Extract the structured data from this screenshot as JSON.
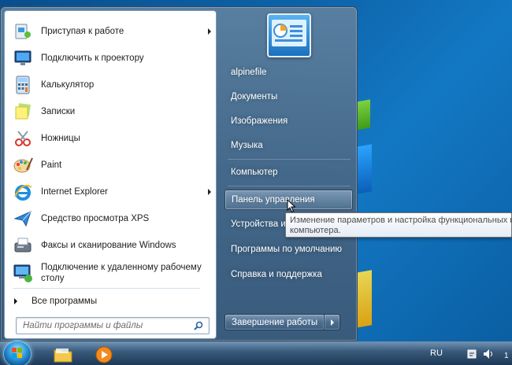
{
  "start_menu": {
    "programs": [
      {
        "label": "Приступая к работе",
        "icon": "getting-started-icon",
        "has_submenu": true
      },
      {
        "label": "Подключить к проектору",
        "icon": "projector-icon",
        "has_submenu": false
      },
      {
        "label": "Калькулятор",
        "icon": "calculator-icon",
        "has_submenu": false
      },
      {
        "label": "Записки",
        "icon": "sticky-notes-icon",
        "has_submenu": false
      },
      {
        "label": "Ножницы",
        "icon": "snipping-tool-icon",
        "has_submenu": false
      },
      {
        "label": "Paint",
        "icon": "paint-icon",
        "has_submenu": false
      },
      {
        "label": "Internet Explorer",
        "icon": "internet-explorer-icon",
        "has_submenu": true
      },
      {
        "label": "Средство просмотра XPS",
        "icon": "xps-viewer-icon",
        "has_submenu": false
      },
      {
        "label": "Факсы и сканирование Windows",
        "icon": "fax-scan-icon",
        "has_submenu": false
      },
      {
        "label_line1": "Подключение к удаленному рабочему",
        "label_line2": "столу",
        "icon": "remote-desktop-icon",
        "has_submenu": false
      }
    ],
    "all_programs": "Все программы",
    "search_placeholder": "Найти программы и файлы",
    "right_items": [
      {
        "label": "alpinefile"
      },
      {
        "label": "Документы"
      },
      {
        "label": "Изображения"
      },
      {
        "label": "Музыка"
      },
      {
        "label": "Компьютер"
      },
      {
        "label": "Панель управления"
      },
      {
        "label": "Устройства и"
      },
      {
        "label": "Программы по умолчанию"
      },
      {
        "label": "Справка и поддержка"
      }
    ],
    "shutdown_label": "Завершение работы",
    "tooltip": {
      "line1": "Изменение параметров и настройка функциональных воз",
      "line2": "компьютера."
    }
  },
  "taskbar": {
    "language": "RU",
    "clock_partial": "1"
  },
  "colors": {
    "menu_bg": "#4e7296",
    "accent_blue": "#1378c4"
  }
}
